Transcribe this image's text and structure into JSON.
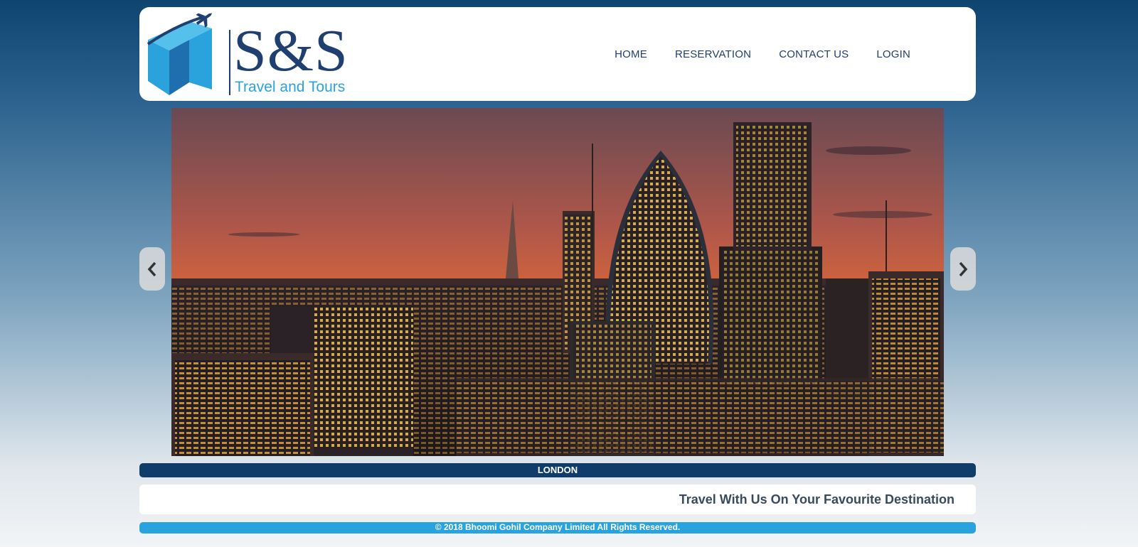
{
  "brand": {
    "logo_text": "S&S",
    "logo_subtitle": "Travel and Tours"
  },
  "nav": {
    "items": [
      "HOME",
      "RESERVATION",
      "CONTACT US",
      "LOGIN"
    ]
  },
  "slider": {
    "caption": "LONDON"
  },
  "tagline": "Travel With Us On Your Favourite Destination",
  "footer": "© 2018 Bhoomi Gohil Company Limited All Rights Reserved.",
  "colors": {
    "brand_navy": "#1f3f71",
    "brand_cyan": "#29a3dd",
    "caption_bg": "#0f3c68"
  },
  "icons": {
    "prev": "chevron-left-icon",
    "next": "chevron-right-icon",
    "logo": "airplane-arrow-logo-icon"
  }
}
